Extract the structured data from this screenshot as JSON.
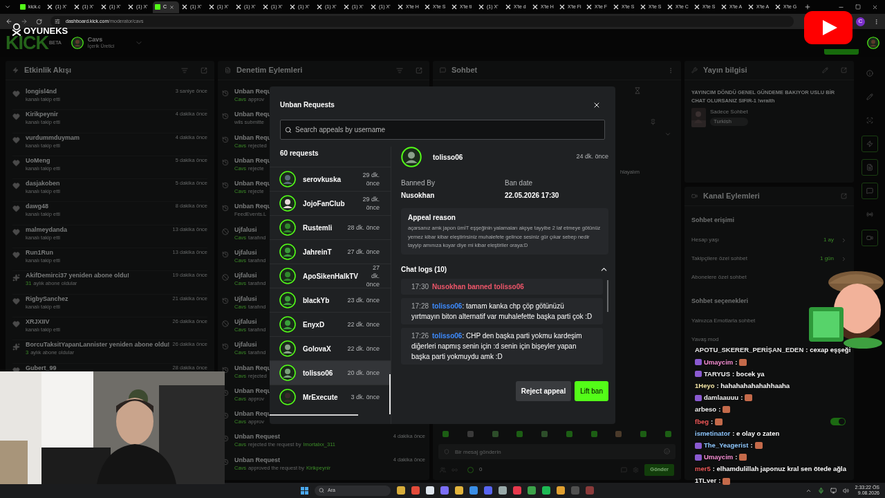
{
  "browser": {
    "tabs": [
      {
        "kind": "kick",
        "title": "kick.c",
        "selected": false
      },
      {
        "kind": "x",
        "title": "(1) X'",
        "selected": false
      },
      {
        "kind": "x",
        "title": "(1) X'",
        "selected": false
      },
      {
        "kind": "x",
        "title": "(1) X'",
        "selected": false
      },
      {
        "kind": "x",
        "title": "(1) X'",
        "selected": false
      },
      {
        "kind": "kick",
        "title": "C",
        "selected": true
      },
      {
        "kind": "x",
        "title": "(1) X'",
        "selected": false
      },
      {
        "kind": "x",
        "title": "(1) X'",
        "selected": false
      },
      {
        "kind": "x",
        "title": "(1) X'",
        "selected": false
      },
      {
        "kind": "x",
        "title": "(1) X'",
        "selected": false
      },
      {
        "kind": "x",
        "title": "(1) X'",
        "selected": false
      },
      {
        "kind": "x",
        "title": "(1) X'",
        "selected": false
      },
      {
        "kind": "x",
        "title": "(1) X'",
        "selected": false
      },
      {
        "kind": "x",
        "title": "(1) X'",
        "selected": false
      },
      {
        "kind": "x",
        "title": "X'te H",
        "selected": false
      },
      {
        "kind": "x",
        "title": "X'te S",
        "selected": false
      },
      {
        "kind": "x",
        "title": "X'te ti",
        "selected": false
      },
      {
        "kind": "x",
        "title": "(1) X'",
        "selected": false
      },
      {
        "kind": "x",
        "title": "X'te d",
        "selected": false
      },
      {
        "kind": "x",
        "title": "X'te H",
        "selected": false
      },
      {
        "kind": "x",
        "title": "X'te Fi",
        "selected": false
      },
      {
        "kind": "x",
        "title": "X'te F",
        "selected": false
      },
      {
        "kind": "x",
        "title": "X'te S",
        "selected": false
      },
      {
        "kind": "x",
        "title": "X'te S",
        "selected": false
      },
      {
        "kind": "x",
        "title": "X'te C",
        "selected": false
      },
      {
        "kind": "x",
        "title": "X'te S",
        "selected": false
      },
      {
        "kind": "x",
        "title": "X'te A",
        "selected": false
      },
      {
        "kind": "x",
        "title": "X'te A",
        "selected": false
      },
      {
        "kind": "x",
        "title": "X'te G",
        "selected": false
      }
    ],
    "url_host": "dashboard.kick.com",
    "url_path": "/moderator/cavs",
    "extension_badge": "C"
  },
  "overlay_logo": "OYUNEKS",
  "header": {
    "logo": "KICK",
    "beta": "BETA",
    "channel": "Cavs",
    "role": "İçerik Üretici"
  },
  "activity": {
    "title": "Etkinlik Akışı",
    "items": [
      {
        "kind": "follow",
        "name": "longisl4nd",
        "sub": "kanalı takip etti",
        "time": "3 saniye önce"
      },
      {
        "kind": "follow",
        "name": "Kirikpeynir",
        "sub": "kanalı takip etti",
        "time": "4 dakika önce"
      },
      {
        "kind": "follow",
        "name": "vurdummduymam",
        "sub": "kanalı takip etti",
        "time": "4 dakika önce"
      },
      {
        "kind": "follow",
        "name": "UoMeng",
        "sub": "kanalı takip etti",
        "time": "5 dakika önce"
      },
      {
        "kind": "follow",
        "name": "dasjakoben",
        "sub": "kanalı takip etti",
        "time": "5 dakika önce"
      },
      {
        "kind": "follow",
        "name": "dawg48",
        "sub": "kanalı takip etti",
        "time": "8 dakika önce"
      },
      {
        "kind": "follow",
        "name": "malmeydanda",
        "sub": "kanalı takip etti",
        "time": "13 dakika önce"
      },
      {
        "kind": "follow",
        "name": "Run1Run",
        "sub": "kanalı takip etti",
        "time": "13 dakika önce"
      },
      {
        "kind": "resub",
        "name": "AkifDemirci37 yeniden abone oldu!",
        "count": "31",
        "sub": "aylık abone oldular",
        "time": "19 dakika önce"
      },
      {
        "kind": "follow",
        "name": "RigbySanchez",
        "sub": "kanalı takip etti",
        "time": "21 dakika önce"
      },
      {
        "kind": "follow",
        "name": "XRJXIIV",
        "sub": "kanalı takip etti",
        "time": "26 dakika önce"
      },
      {
        "kind": "resub",
        "name": "BorcuTaksitYapanLannister yeniden abone oldu!",
        "count": "3",
        "sub": "aylık abone oldular",
        "time": "26 dakika önce"
      },
      {
        "kind": "follow",
        "name": "Gubert_99",
        "time": "28 dakika önce"
      }
    ]
  },
  "moderation": {
    "title": "Denetim Eylemleri",
    "items": [
      {
        "kind": "unban",
        "title": "Unban Requ",
        "actor": "Cavs",
        "detail": "approv"
      },
      {
        "kind": "unban",
        "title": "Unban Requ",
        "detail": "wils submitte"
      },
      {
        "kind": "unban",
        "title": "Unban Requ",
        "actor": "Cavs",
        "detail": "rejected"
      },
      {
        "kind": "unban",
        "title": "Unban Requ",
        "actor": "Cavs",
        "detail": "rejecte"
      },
      {
        "kind": "unban",
        "title": "Unban Requ",
        "actor": "Cavs",
        "detail": "rejecte"
      },
      {
        "kind": "unban",
        "title": "Unban Requ",
        "detail": "FeedEvents.L"
      },
      {
        "kind": "ban",
        "title": "Ujfalusi",
        "actor": "Cavs",
        "detail": "tarafınd"
      },
      {
        "kind": "unban",
        "title": "Ujfalusi",
        "actor": "Cavs",
        "detail": "tarafınd"
      },
      {
        "kind": "ban",
        "title": "Ujfalusi",
        "actor": "Cavs",
        "detail": "tarafınd"
      },
      {
        "kind": "unban",
        "title": "Ujfalusi",
        "actor": "Cavs",
        "detail": "tarafınd"
      },
      {
        "kind": "ban",
        "title": "Ujfalusi",
        "actor": "Cavs",
        "detail": "tarafınd"
      },
      {
        "kind": "unban",
        "title": "Ujfalusi",
        "actor": "Cavs",
        "detail": "tarafınd"
      },
      {
        "kind": "unban",
        "title": "Unban Requ",
        "actor": "Cavs",
        "detail": "rejected"
      },
      {
        "kind": "unban",
        "title": "Unban Requ",
        "actor": "Cavs",
        "detail": "approv"
      },
      {
        "kind": "unban",
        "title": "Unban Requ",
        "actor": "Cavs",
        "detail": "approv"
      },
      {
        "kind": "unban",
        "title": "Unban Request",
        "actor": "Cavs",
        "detail": "rejected the request by",
        "target": "Imortalxx_311",
        "time": "4 dakika önce"
      },
      {
        "kind": "unban",
        "title": "Unban Request",
        "actor": "Cavs",
        "detail": "approved the request by",
        "target": "Kirikpeynir",
        "time": "4 dakika önce"
      }
    ]
  },
  "chat": {
    "title": "Sohbet",
    "partial_message": "hlayalım",
    "input_placeholder": "Bir mesaj gönderin",
    "viewer_count": "0",
    "send": "Gönder"
  },
  "stream_info": {
    "title": "Yayın bilgisi",
    "stream_title": "YAYINCIM DÖNDÜ GENEL GÜNDEME BAKIYOR USLU BİR CHAT OLURSANIZ SIFIR-1 !wraith",
    "category": "Sadece Sohbet",
    "tag": "Turkish"
  },
  "channel_actions": {
    "title": "Kanal Eylemleri",
    "sections": [
      {
        "heading": "Sohbet erişimi",
        "rows": [
          {
            "label": "Hesap yaşı",
            "value": "1 ay"
          },
          {
            "label": "Takipçilere özel sohbet",
            "value": "1 gün"
          },
          {
            "label": "Abonelere özel sohbet"
          }
        ]
      },
      {
        "heading": "Sohbet seçenekleri",
        "rows": [
          {
            "label": "Yalnızca Emotlarla sohbet"
          },
          {
            "label": "Yavaş mod"
          }
        ]
      }
    ],
    "view_count_toggle": {
      "on": true
    }
  },
  "modal": {
    "title": "Unban Requests",
    "search_placeholder": "Search appeals by username",
    "count": "60 requests",
    "requests": [
      {
        "name": "serovkuska",
        "time": "29 dk. önce",
        "selected": false
      },
      {
        "name": "JojoFanClub",
        "time": "29 dk. önce",
        "selected": false
      },
      {
        "name": "Rustemli",
        "time": "28 dk. önce",
        "selected": false
      },
      {
        "name": "JahreinT",
        "time": "27 dk. önce",
        "selected": false
      },
      {
        "name": "ApoSikenHalkTV",
        "time": "27 dk. önce",
        "selected": false
      },
      {
        "name": "blackYb",
        "time": "23 dk. önce",
        "selected": false
      },
      {
        "name": "EnyxD",
        "time": "22 dk. önce",
        "selected": false
      },
      {
        "name": "GolovaX",
        "time": "22 dk. önce",
        "selected": false
      },
      {
        "name": "tolisso06",
        "time": "20 dk. önce",
        "selected": true
      },
      {
        "name": "MrExecute",
        "time": "3 dk. önce",
        "selected": false
      }
    ],
    "detail": {
      "name": "tolisso06",
      "time": "24 dk. önce",
      "banned_by_label": "Banned By",
      "banned_by": "Nusokhan",
      "ban_date_label": "Ban date",
      "ban_date": "22.05.2026 17:30",
      "appeal_label": "Appeal reason",
      "appeal": "açarsanız amk japon ümİT eşşeğinin yalamaları akpye tayyibe 2 laf etmeye götünüz yemez kibar kibar eleştirirsiniz muhalefete gelince sesiniz gür çıkar sebep nedir tayyip amınıza koyar diye mi kibar eleştiriler oraya:D",
      "logs_label": "Chat logs (10)",
      "logs_expanded": true,
      "logs": [
        {
          "kind": "ban",
          "time": "17:30",
          "text": "Nusokhan banned tolisso06"
        },
        {
          "kind": "message",
          "time": "17:28",
          "user": "tolisso06",
          "text": ": tamam kanka chp çöp götünüzü yırtmayın biton alternatif var muhalefette başka parti çok :D"
        },
        {
          "kind": "message",
          "time": "17:26",
          "user": "tolisso06",
          "text": ": CHP den başka parti yokmu kardeşim diğerleri napmış senin için :d senin için bişeyler yapan başka parti yokmuydu amk :D"
        }
      ]
    },
    "reject": "Reject appeal",
    "lift": "Lift ban"
  },
  "stream_chat": [
    {
      "name": "APOTU_SKERER_PERİŞAN_EDEN",
      "color": "#e8e8e8",
      "text": ": cexap eşşeği"
    },
    {
      "name": "Umaycim",
      "color": "#f78fd4",
      "badges": true,
      "emote": true,
      "text": ":"
    },
    {
      "name": "TARYUS",
      "color": "#f0f0f0",
      "badges": true,
      "text": ": bocek ya"
    },
    {
      "name": "1Heyo",
      "color": "#f5e7a8",
      "text": ": hahahahahahahhaaha"
    },
    {
      "name": "damlaauuu",
      "color": "#f0f0f0",
      "badges": true,
      "emote": true,
      "text": ":"
    },
    {
      "name": "arbeso",
      "color": "#f0f0f0",
      "emote": true,
      "text": ":"
    },
    {
      "name": "fbeg",
      "color": "#f05a5a",
      "emote": true,
      "text": ":"
    },
    {
      "name": "ismetinator",
      "color": "#8fc8ff",
      "text": ": e olay o zaten"
    },
    {
      "name": "The_Yeagerist",
      "color": "#8fc8ff",
      "badges": true,
      "emote": true,
      "text": ":"
    },
    {
      "name": "Umaycim",
      "color": "#f78fd4",
      "badges": true,
      "emote": true,
      "text": ":"
    },
    {
      "name": "mer5",
      "color": "#f05a5a",
      "text": ": elhamdulillah japonuz kral sen ötede ağla"
    },
    {
      "name": "1TLver",
      "color": "#f0f0f0",
      "emote": true,
      "text": ":"
    }
  ],
  "taskbar": {
    "search": "Ara",
    "time": "2:33:22 ÖS",
    "date": "9.08.2026"
  }
}
